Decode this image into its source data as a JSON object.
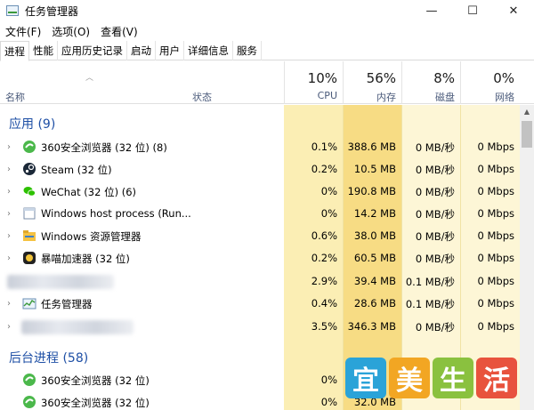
{
  "window": {
    "title": "任务管理器",
    "minimize": "—",
    "maximize": "☐",
    "close": "✕"
  },
  "menu": [
    "文件(F)",
    "选项(O)",
    "查看(V)"
  ],
  "tabs": [
    "进程",
    "性能",
    "应用历史记录",
    "启动",
    "用户",
    "详细信息",
    "服务"
  ],
  "active_tab": "进程",
  "header": {
    "name": "名称",
    "status": "状态",
    "cpu": {
      "percent": "10%",
      "label": "CPU"
    },
    "memory": {
      "percent": "56%",
      "label": "内存"
    },
    "disk": {
      "percent": "8%",
      "label": "磁盘"
    },
    "network": {
      "percent": "0%",
      "label": "网络"
    }
  },
  "groups": {
    "apps": "应用 (9)",
    "background": "后台进程 (58)"
  },
  "app_rows": [
    {
      "name": "360安全浏览器 (32 位) (8)",
      "icon": "360-browser-icon",
      "cpu": "0.1%",
      "mem": "388.6 MB",
      "disk": "0 MB/秒",
      "net": "0 Mbps"
    },
    {
      "name": "Steam (32 位)",
      "icon": "steam-icon",
      "cpu": "0.2%",
      "mem": "10.5 MB",
      "disk": "0 MB/秒",
      "net": "0 Mbps"
    },
    {
      "name": "WeChat (32 位) (6)",
      "icon": "wechat-icon",
      "cpu": "0%",
      "mem": "190.8 MB",
      "disk": "0 MB/秒",
      "net": "0 Mbps"
    },
    {
      "name": "Windows host process (Run...",
      "icon": "window-icon",
      "cpu": "0%",
      "mem": "14.2 MB",
      "disk": "0 MB/秒",
      "net": "0 Mbps"
    },
    {
      "name": "Windows 资源管理器",
      "icon": "explorer-icon",
      "cpu": "0.6%",
      "mem": "38.0 MB",
      "disk": "0 MB/秒",
      "net": "0 Mbps"
    },
    {
      "name": "暴喵加速器 (32 位)",
      "icon": "accelerator-icon",
      "cpu": "0.2%",
      "mem": "60.5 MB",
      "disk": "0 MB/秒",
      "net": "0 Mbps"
    },
    {
      "name": "",
      "icon": "blurred-icon",
      "cpu": "2.9%",
      "mem": "39.4 MB",
      "disk": "0.1 MB/秒",
      "net": "0 Mbps"
    },
    {
      "name": "任务管理器",
      "icon": "task-manager-icon",
      "cpu": "0.4%",
      "mem": "28.6 MB",
      "disk": "0.1 MB/秒",
      "net": "0 Mbps"
    },
    {
      "name": "",
      "icon": "blurred-icon",
      "cpu": "3.5%",
      "mem": "346.3 MB",
      "disk": "0 MB/秒",
      "net": "0 Mbps"
    }
  ],
  "bg_rows": [
    {
      "name": "360安全浏览器 (32 位)",
      "icon": "360-browser-icon",
      "cpu": "0%",
      "mem": "",
      "disk": "",
      "net": ""
    },
    {
      "name": "360安全浏览器 (32 位)",
      "icon": "360-browser-icon",
      "cpu": "0%",
      "mem": "32.0 MB",
      "disk": "",
      "net": ""
    }
  ],
  "watermark": [
    "宜",
    "美",
    "生",
    "活"
  ],
  "colors": {
    "cpu_bg": "#fbeeb4",
    "mem_bg": "#f7dc84",
    "light_bg": "#fdf6d6",
    "group": "#1e4fa5",
    "wm1": "#2aa3d8",
    "wm2": "#f2a623",
    "wm3": "#8ac13f",
    "wm4": "#e8533d"
  }
}
